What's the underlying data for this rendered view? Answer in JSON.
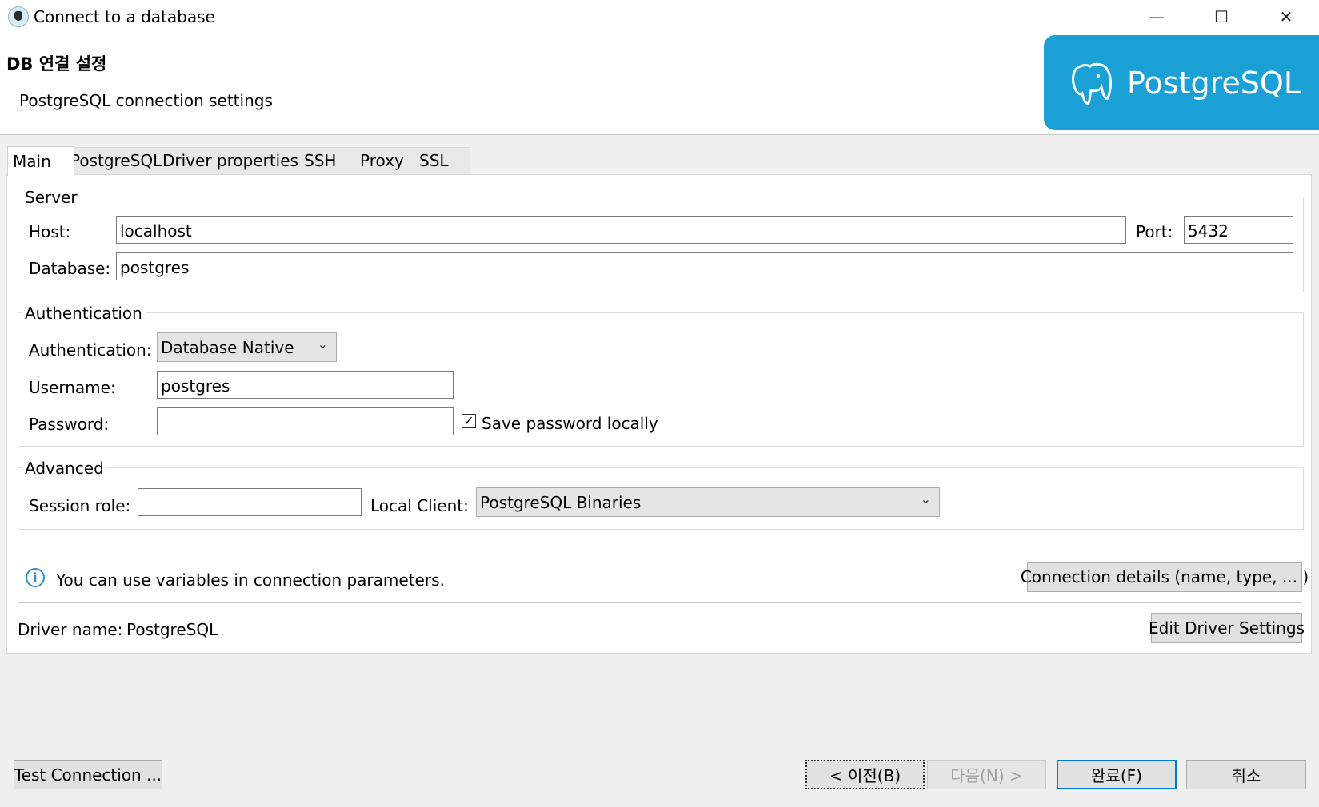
{
  "window": {
    "title": "Connect to a database",
    "minimize": "—",
    "maximize": "☐",
    "close": "✕"
  },
  "header": {
    "title": "DB 연결 설정",
    "subtitle": "PostgreSQL connection settings",
    "logo_text": "PostgreSQL",
    "brand_color": "#1aa0d4"
  },
  "tabs": [
    "Main",
    "PostgreSQL",
    "Driver properties",
    "SSH",
    "Proxy",
    "SSL"
  ],
  "server": {
    "legend": "Server",
    "host_label": "Host:",
    "host_value": "localhost",
    "port_label": "Port:",
    "port_value": "5432",
    "database_label": "Database:",
    "database_value": "postgres"
  },
  "auth": {
    "legend": "Authentication",
    "auth_label": "Authentication:",
    "auth_value": "Database Native",
    "username_label": "Username:",
    "username_value": "postgres",
    "password_label": "Password:",
    "password_value": "",
    "save_password_label": "Save password locally",
    "save_password_checked": "✓"
  },
  "advanced": {
    "legend": "Advanced",
    "session_role_label": "Session role:",
    "session_role_value": "",
    "local_client_label": "Local Client:",
    "local_client_value": "PostgreSQL Binaries"
  },
  "info": {
    "text": "You can use variables in connection parameters.",
    "icon": "i"
  },
  "connection_details_button": "Connection details (name, type, ... )",
  "driver": {
    "label": "Driver name:",
    "value": "PostgreSQL",
    "edit_button": "Edit Driver Settings"
  },
  "footer": {
    "test_button": "Test Connection ...",
    "back_button": "< 이전(B)",
    "next_button": "다음(N) >",
    "finish_button": "완료(F)",
    "cancel_button": "취소"
  }
}
